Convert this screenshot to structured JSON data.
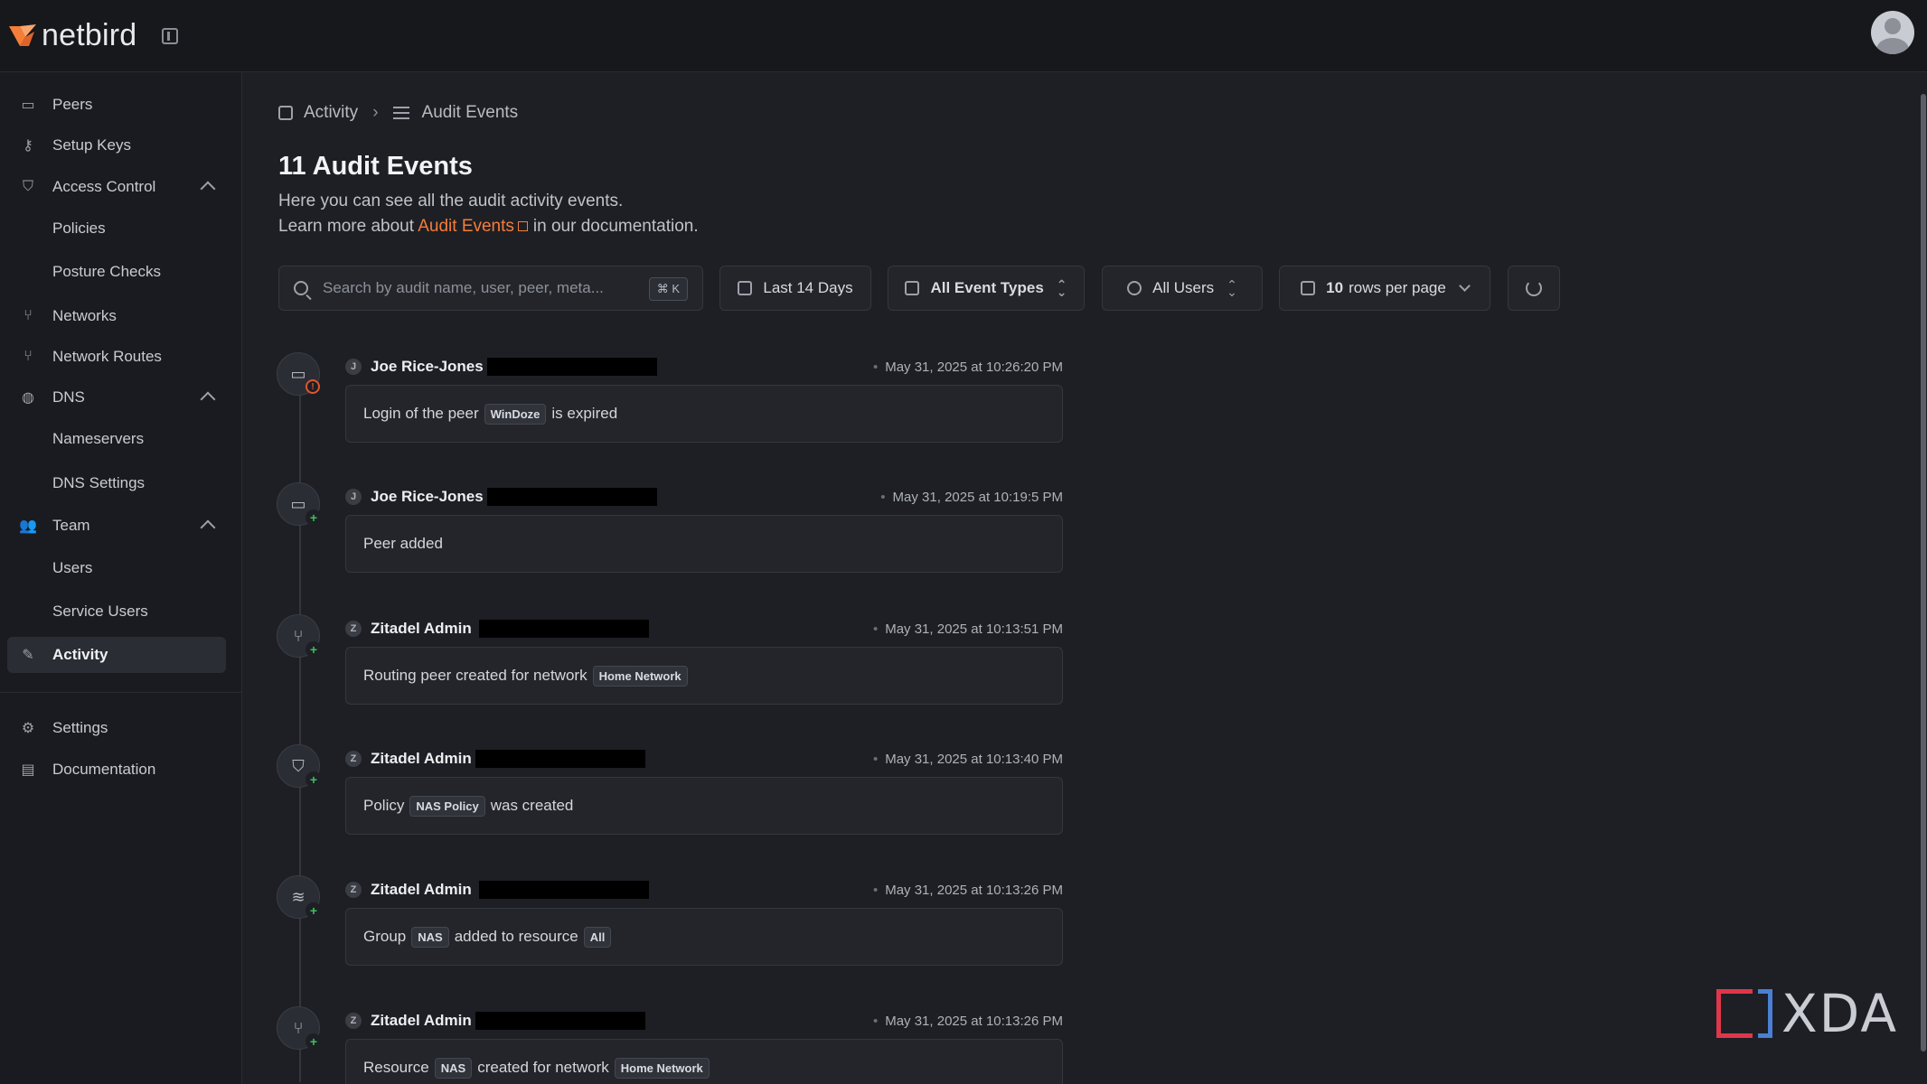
{
  "app": {
    "name": "netbird"
  },
  "sidebar": {
    "items": [
      {
        "label": "Peers",
        "icon": "monitor-icon"
      },
      {
        "label": "Setup Keys",
        "icon": "key-icon"
      },
      {
        "label": "Access Control",
        "icon": "shield-icon"
      },
      {
        "label": "Policies"
      },
      {
        "label": "Posture Checks"
      },
      {
        "label": "Networks",
        "icon": "network-icon"
      },
      {
        "label": "Network Routes",
        "icon": "network-routes-icon"
      },
      {
        "label": "DNS",
        "icon": "globe-icon"
      },
      {
        "label": "Nameservers"
      },
      {
        "label": "DNS Settings"
      },
      {
        "label": "Team",
        "icon": "team-icon"
      },
      {
        "label": "Users"
      },
      {
        "label": "Service Users"
      },
      {
        "label": "Activity",
        "icon": "activity-icon"
      },
      {
        "label": "Settings",
        "icon": "gear-icon"
      },
      {
        "label": "Documentation",
        "icon": "book-icon"
      }
    ]
  },
  "breadcrumb": {
    "parent": "Activity",
    "current": "Audit Events"
  },
  "page": {
    "title": "11 Audit Events",
    "desc1": "Here you can see all the audit activity events.",
    "desc2_prefix": "Learn more about",
    "desc2_link": "Audit Events",
    "desc2_suffix": "in our documentation."
  },
  "toolbar": {
    "search_placeholder": "Search by audit name, user, peer, meta...",
    "search_shortcut": "⌘ K",
    "date_filter": "Last 14 Days",
    "event_types": "All Event Types",
    "users_filter": "All Users",
    "rows_count": "10",
    "rows_label": "rows per page"
  },
  "events": [
    {
      "initial": "J",
      "user": "Joe Rice-Jones",
      "time": "May 31, 2025 at 10:26:20 PM",
      "pre": "Login of the peer",
      "tag": "WinDoze",
      "post": "is expired",
      "icon": "peer-icon",
      "badge": "warning"
    },
    {
      "initial": "J",
      "user": "Joe Rice-Jones",
      "time": "May 31, 2025 at 10:19:5 PM",
      "pre": "Peer added",
      "icon": "peer-icon",
      "badge": "plus"
    },
    {
      "initial": "Z",
      "user": "Zitadel Admin",
      "time": "May 31, 2025 at 10:13:51 PM",
      "pre": "Routing peer created for network",
      "tag": "Home Network",
      "icon": "routing-icon",
      "badge": "plus"
    },
    {
      "initial": "Z",
      "user": "Zitadel Admin",
      "time": "May 31, 2025 at 10:13:40 PM",
      "pre": "Policy",
      "tag": "NAS Policy",
      "post": "was created",
      "icon": "shield-icon",
      "badge": "plus"
    },
    {
      "initial": "Z",
      "user": "Zitadel Admin",
      "time": "May 31, 2025 at 10:13:26 PM",
      "pre": "Group",
      "tag": "NAS",
      "mid": "added to resource",
      "tag2": "All",
      "icon": "layers-icon",
      "badge": "plus"
    },
    {
      "initial": "Z",
      "user": "Zitadel Admin",
      "time": "May 31, 2025 at 10:13:26 PM",
      "pre": "Resource",
      "tag": "NAS",
      "mid": "created for network",
      "tag2": "Home Network",
      "icon": "routing-icon",
      "badge": "plus"
    }
  ],
  "watermark": {
    "text": "XDA"
  },
  "colors": {
    "accent": "#f57d3a",
    "background": "#1d1f24",
    "plus": "#3fbf5f",
    "warning": "#e0562f"
  }
}
